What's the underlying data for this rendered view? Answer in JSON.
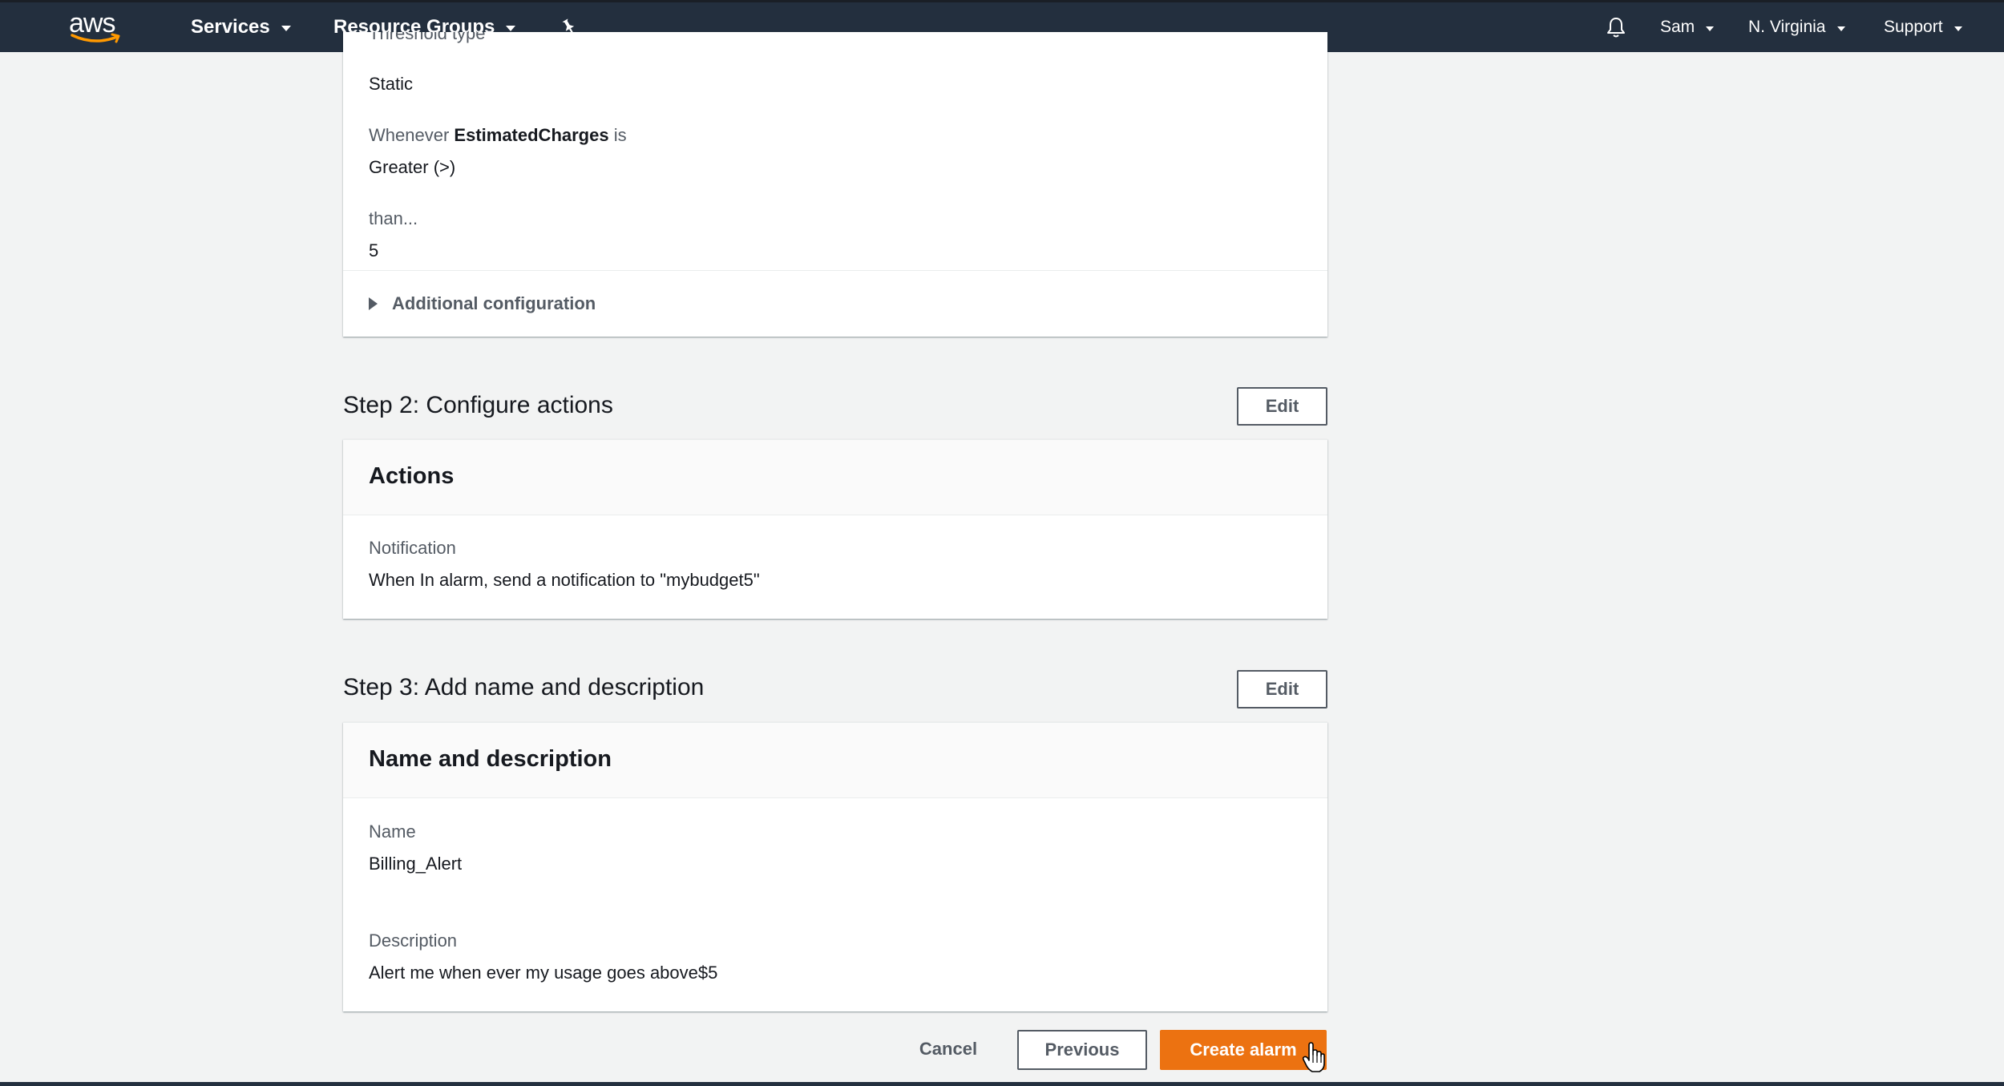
{
  "nav": {
    "logo_text": "aws",
    "services": "Services",
    "resource_groups": "Resource Groups",
    "user": "Sam",
    "region": "N. Virginia",
    "support": "Support"
  },
  "conditions": {
    "threshold_type_label": "Threshold type",
    "threshold_type_value": "Static",
    "whenever_prefix": "Whenever",
    "whenever_metric": "EstimatedCharges",
    "whenever_suffix": "is",
    "whenever_value": "Greater (>)",
    "than_label": "than...",
    "than_value": "5",
    "additional_configuration": "Additional configuration"
  },
  "step2": {
    "title": "Step 2: Configure actions",
    "edit_label": "Edit",
    "card_title": "Actions",
    "notification_label": "Notification",
    "notification_value": "When In alarm, send a notification to \"mybudget5\""
  },
  "step3": {
    "title": "Step 3: Add name and description",
    "edit_label": "Edit",
    "card_title": "Name and description",
    "name_label": "Name",
    "name_value": "Billing_Alert",
    "description_label": "Description",
    "description_value": "Alert me when ever my usage goes above$5"
  },
  "footer": {
    "cancel_label": "Cancel",
    "previous_label": "Previous",
    "create_label": "Create alarm"
  },
  "colors": {
    "nav_bg": "#232f3e",
    "primary": "#ec7211",
    "page_bg": "#f2f3f3"
  }
}
